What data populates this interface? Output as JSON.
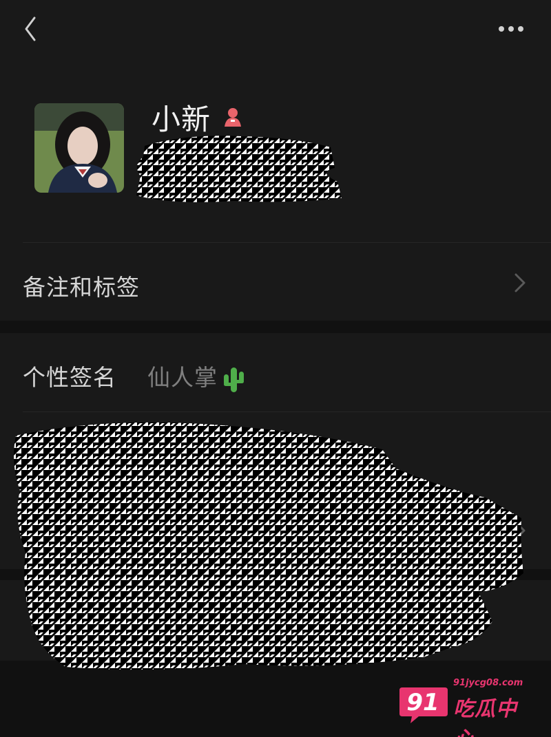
{
  "header": {
    "back_icon": "chevron-left-icon",
    "more_icon": "ellipsis-icon"
  },
  "profile": {
    "name": "小新",
    "gender_icon": "female-icon",
    "gender_color": "#e8646b"
  },
  "rows": {
    "remark_label": "备注和标签",
    "signature_label": "个性签名",
    "signature_value": "仙人掌"
  },
  "watermark": {
    "number": "91",
    "url": "91jycg08.com",
    "text": "吃瓜中心",
    "color": "#e8356f"
  },
  "colors": {
    "background": "#191919",
    "band": "#111111"
  }
}
